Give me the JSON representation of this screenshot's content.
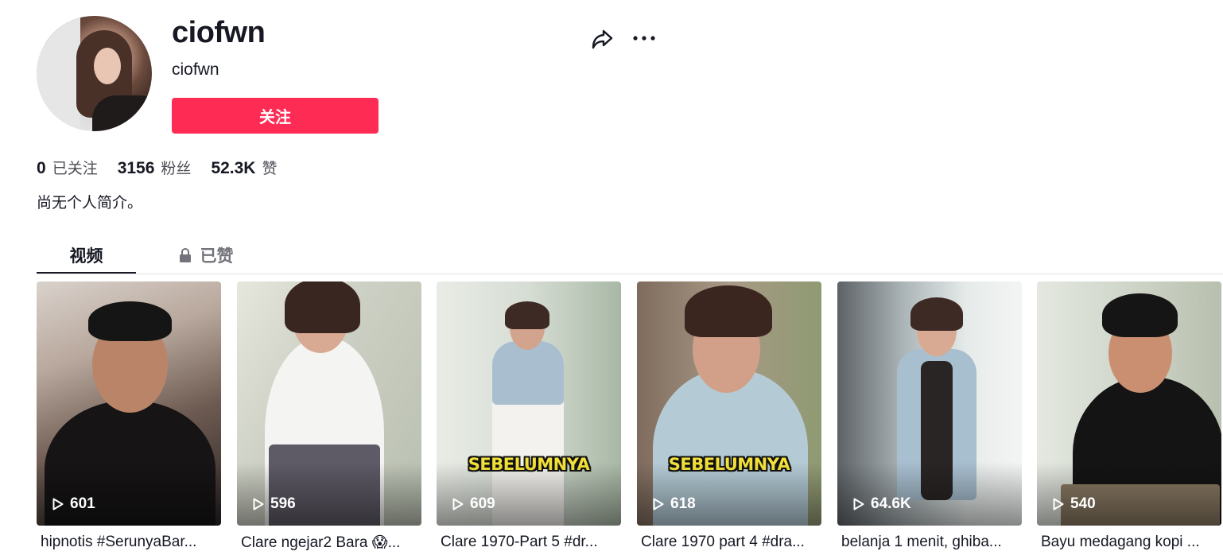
{
  "profile": {
    "username": "ciofwn",
    "nickname": "ciofwn",
    "follow_label": "关注",
    "bio": "尚无个人简介。"
  },
  "actions": {
    "share_icon": "share-arrow-icon",
    "more_icon": "more-horizontal-icon"
  },
  "stats": [
    {
      "value": "0",
      "label": "已关注"
    },
    {
      "value": "3156",
      "label": "粉丝"
    },
    {
      "value": "52.3K",
      "label": "赞"
    }
  ],
  "tabs": [
    {
      "label": "视频",
      "active": true
    },
    {
      "label": "已赞",
      "active": false,
      "icon": "lock-icon"
    }
  ],
  "videos": [
    {
      "views": "601",
      "description": "hipnotis #SerunyaBar...",
      "overlay_text": ""
    },
    {
      "views": "596",
      "description": "Clare ngejar2 Bara 😱...",
      "overlay_text": ""
    },
    {
      "views": "609",
      "description": "Clare 1970-Part 5 #dr...",
      "overlay_text": "SEBELUMNYA"
    },
    {
      "views": "618",
      "description": "Clare 1970 part 4 #dra...",
      "overlay_text": "SEBELUMNYA"
    },
    {
      "views": "64.6K",
      "description": "belanja 1 menit, ghiba...",
      "overlay_text": ""
    },
    {
      "views": "540",
      "description": "Bayu medagang kopi ...",
      "overlay_text": ""
    }
  ],
  "colors": {
    "accent": "#fe2c55",
    "text_primary": "#161823",
    "text_secondary": "#73747b"
  }
}
